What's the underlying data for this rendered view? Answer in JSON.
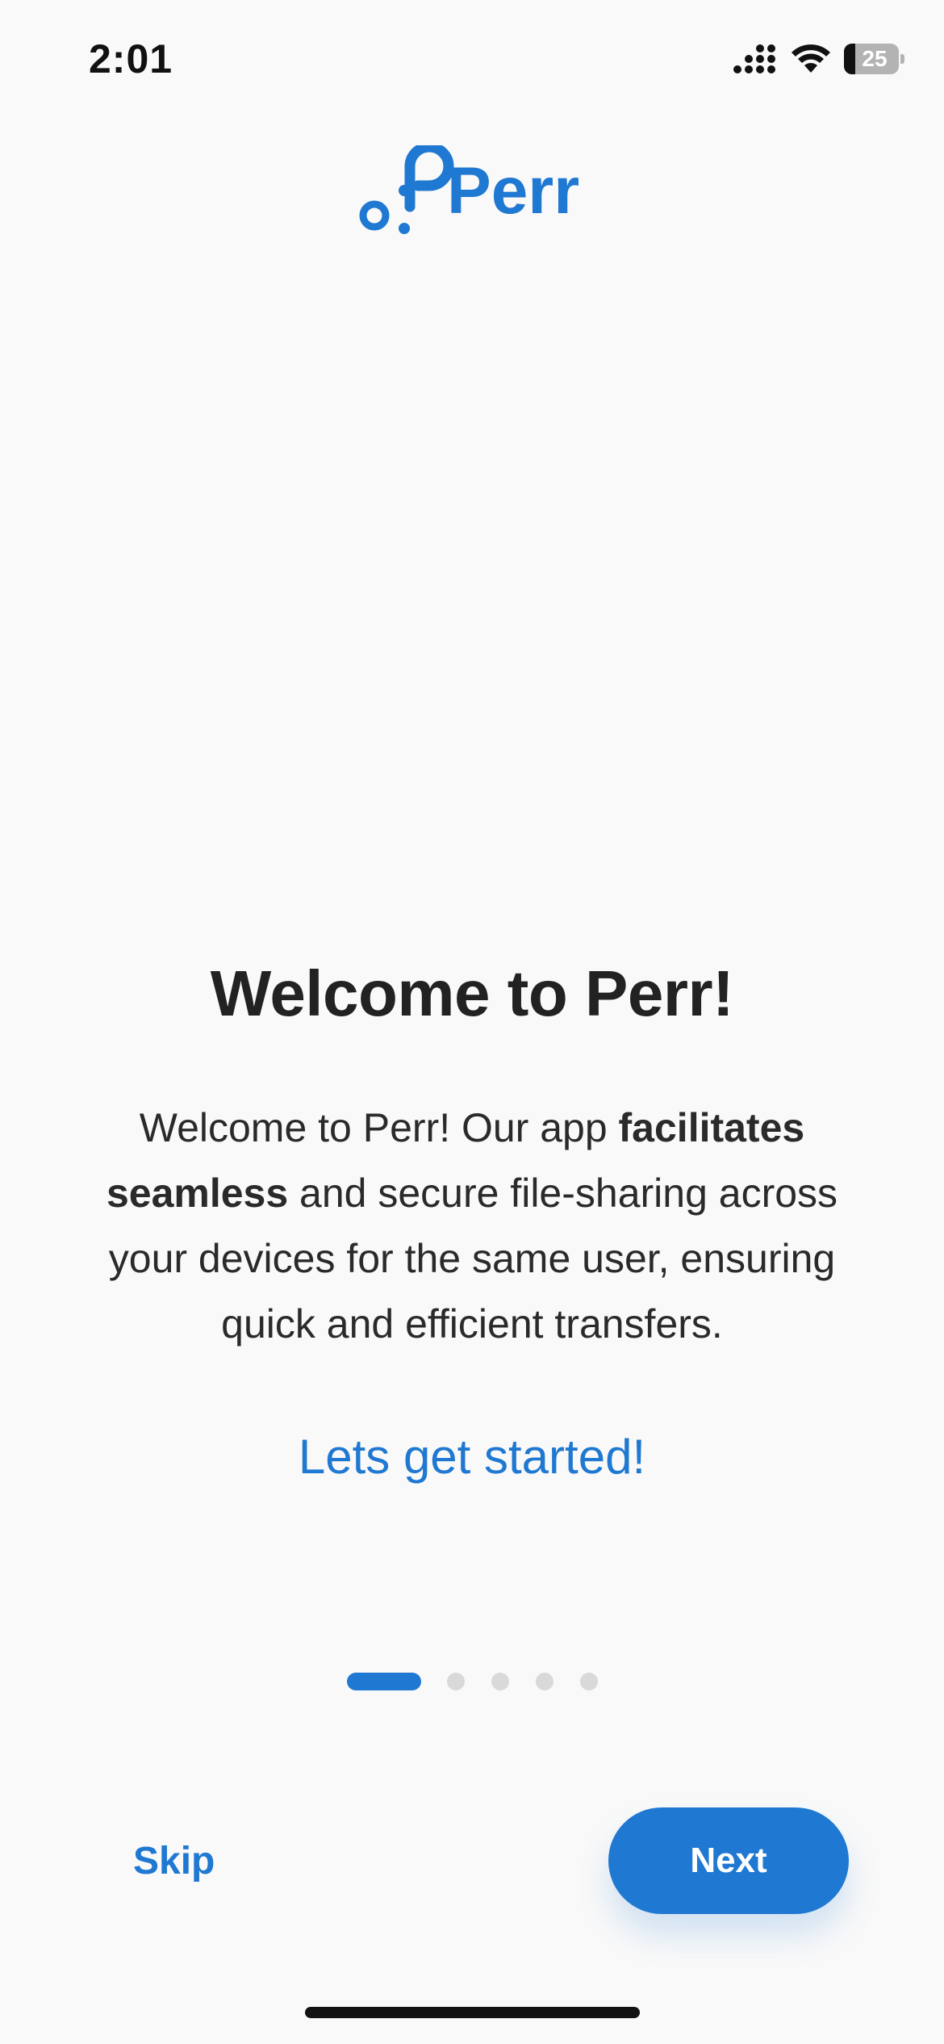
{
  "status_bar": {
    "time": "2:01",
    "battery_percent": "25",
    "icons": [
      "cellular-signal-icon",
      "wifi-icon",
      "battery-icon"
    ]
  },
  "logo": {
    "text": "Perr",
    "color": "#1f78d1"
  },
  "onboarding": {
    "title": "Welcome to Perr!",
    "body_parts": {
      "p1": "Welcome to Perr! Our app ",
      "p2_bold": "facilitates seamless",
      "p3": " and secure file-sharing across your devices for the same user, ensuring quick and efficient transfers."
    },
    "cta": "Lets get started!"
  },
  "pager": {
    "total_pages": 5,
    "current_page": 1
  },
  "buttons": {
    "skip_label": "Skip",
    "next_label": "Next"
  },
  "colors": {
    "accent": "#1f78d1",
    "background": "#f9f9f9",
    "inactive_dot": "#d9d9d9"
  }
}
